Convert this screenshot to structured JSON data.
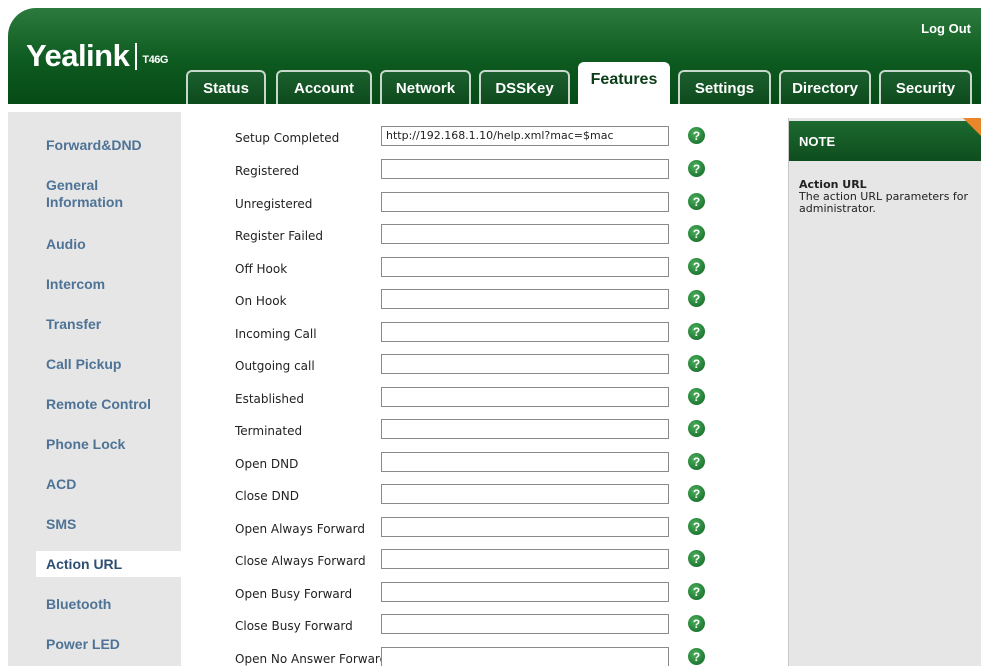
{
  "header": {
    "logout_label": "Log Out",
    "brand": "Yealink",
    "model": "T46G"
  },
  "tabs": [
    {
      "label": "Status"
    },
    {
      "label": "Account"
    },
    {
      "label": "Network"
    },
    {
      "label": "DSSKey"
    },
    {
      "label": "Features",
      "active": true
    },
    {
      "label": "Settings"
    },
    {
      "label": "Directory"
    },
    {
      "label": "Security"
    }
  ],
  "sidebar": {
    "items": [
      {
        "label": "Forward&DND"
      },
      {
        "label": "General Information"
      },
      {
        "label": "Audio"
      },
      {
        "label": "Intercom"
      },
      {
        "label": "Transfer"
      },
      {
        "label": "Call Pickup"
      },
      {
        "label": "Remote Control"
      },
      {
        "label": "Phone Lock"
      },
      {
        "label": "ACD"
      },
      {
        "label": "SMS"
      },
      {
        "label": "Action URL",
        "active": true
      },
      {
        "label": "Bluetooth"
      },
      {
        "label": "Power LED"
      }
    ]
  },
  "form": {
    "help_glyph": "?",
    "rows": [
      {
        "label": "Setup Completed",
        "value": "http://192.168.1.10/help.xml?mac=$mac"
      },
      {
        "label": "Registered",
        "value": ""
      },
      {
        "label": "Unregistered",
        "value": ""
      },
      {
        "label": "Register Failed",
        "value": ""
      },
      {
        "label": "Off Hook",
        "value": ""
      },
      {
        "label": "On Hook",
        "value": ""
      },
      {
        "label": "Incoming Call",
        "value": ""
      },
      {
        "label": "Outgoing call",
        "value": ""
      },
      {
        "label": "Established",
        "value": ""
      },
      {
        "label": "Terminated",
        "value": ""
      },
      {
        "label": "Open DND",
        "value": ""
      },
      {
        "label": "Close DND",
        "value": ""
      },
      {
        "label": "Open Always Forward",
        "value": ""
      },
      {
        "label": "Close Always Forward",
        "value": ""
      },
      {
        "label": "Open Busy Forward",
        "value": ""
      },
      {
        "label": "Close Busy Forward",
        "value": ""
      },
      {
        "label": "Open No Answer Forward",
        "value": ""
      }
    ]
  },
  "note": {
    "heading": "NOTE",
    "title": "Action URL",
    "text": "The action URL parameters for administrator."
  },
  "colors": {
    "brand_green": "#0d5a20",
    "sidebar_link": "#4e7396",
    "note_corner": "#e8872a"
  }
}
